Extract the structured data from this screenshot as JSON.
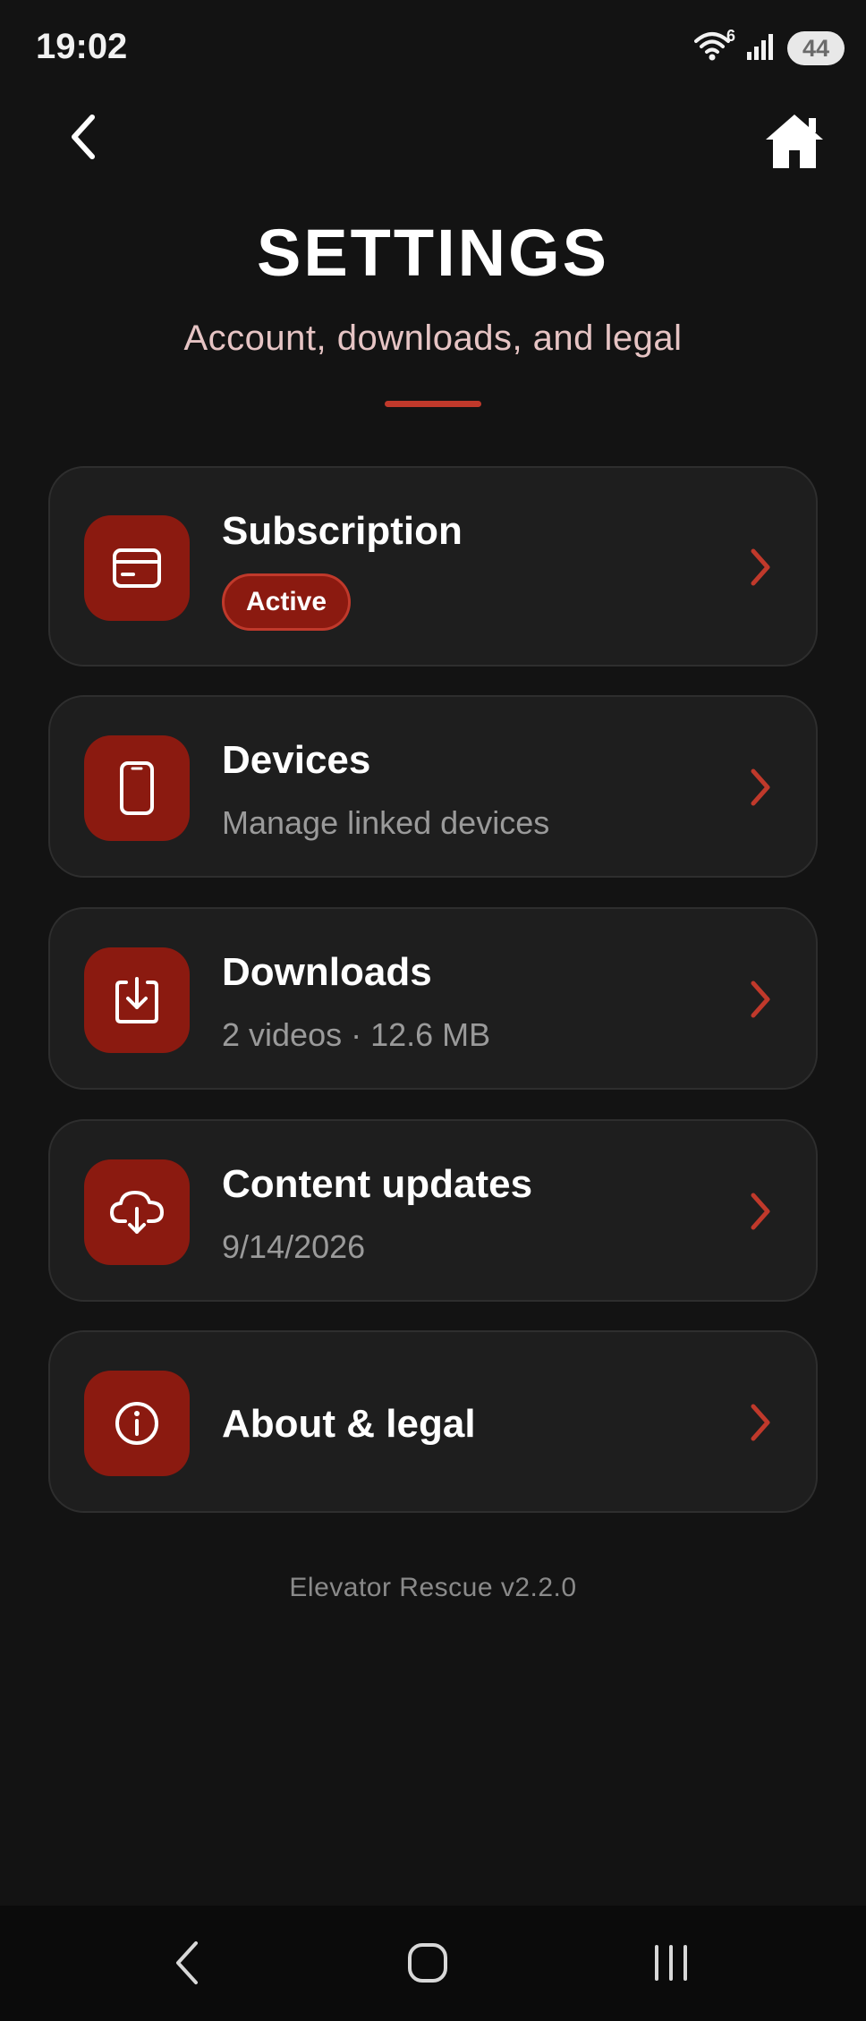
{
  "status_bar": {
    "time": "19:02",
    "wifi_superscript": "6",
    "battery": "44",
    "icons": [
      "wifi-icon",
      "signal-icon",
      "battery-icon"
    ]
  },
  "header": {
    "back_icon": "chevron-left-icon",
    "home_icon": "home-icon",
    "title": "SETTINGS",
    "subtitle": "Account, downloads, and legal"
  },
  "items": [
    {
      "title": "Subscription",
      "badge": "Active",
      "icon": "credit-card-icon"
    },
    {
      "title": "Devices",
      "subtitle": "Manage linked devices",
      "icon": "phone-icon"
    },
    {
      "title": "Downloads",
      "subtitle": "2 videos · 12.6 MB",
      "icon": "download-icon"
    },
    {
      "title": "Content updates",
      "subtitle": "9/14/2026",
      "icon": "cloud-download-icon"
    },
    {
      "title": "About & legal",
      "icon": "info-icon"
    }
  ],
  "version": "Elevator Rescue v2.2.0",
  "nav_bar": {
    "icons": [
      "back-nav-icon",
      "home-nav-icon",
      "recents-nav-icon"
    ]
  },
  "colors": {
    "background": "#131313",
    "card": "#1e1e1e",
    "icon_tile": "#8b1a10",
    "accent": "#c0392b",
    "subtitle": "#e6c4c4"
  }
}
